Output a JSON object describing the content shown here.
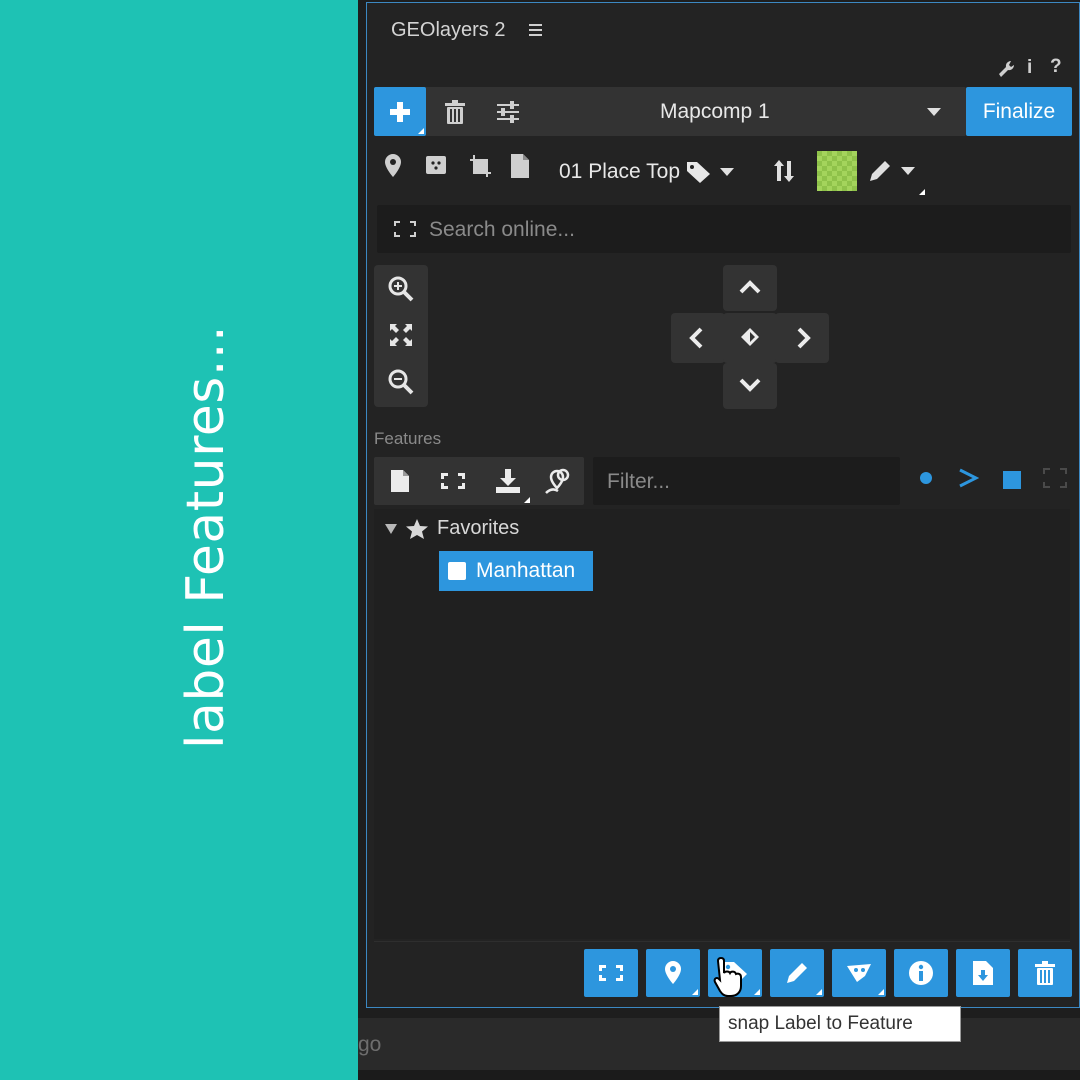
{
  "banner": {
    "text": "label Features..."
  },
  "background": {
    "partial_text": "go"
  },
  "panel": {
    "title": "GEOlayers 2",
    "top_icons": {
      "info": "i",
      "help": "?"
    }
  },
  "toolbar": {
    "mapcomp_value": "Mapcomp 1",
    "finalize_label": "Finalize"
  },
  "style_row": {
    "place_value": "01 Place Top",
    "swatch_color": "#8fc24a"
  },
  "search": {
    "placeholder": "Search online..."
  },
  "features": {
    "section_label": "Features",
    "filter_placeholder": "Filter...",
    "tree": {
      "group_label": "Favorites",
      "items": [
        {
          "label": "Manhattan",
          "selected": true
        }
      ]
    }
  },
  "bottom_toolbar": {
    "buttons": [
      "fit-icon",
      "pin-icon",
      "label-tag-icon",
      "pencil-icon",
      "shape-icon",
      "info-icon",
      "export-file-icon",
      "trash-icon"
    ]
  },
  "tooltip": {
    "text": "snap Label to Feature"
  },
  "colors": {
    "accent": "#2d96de",
    "banner": "#1ec2b4",
    "panel_border": "#3c88c2"
  }
}
